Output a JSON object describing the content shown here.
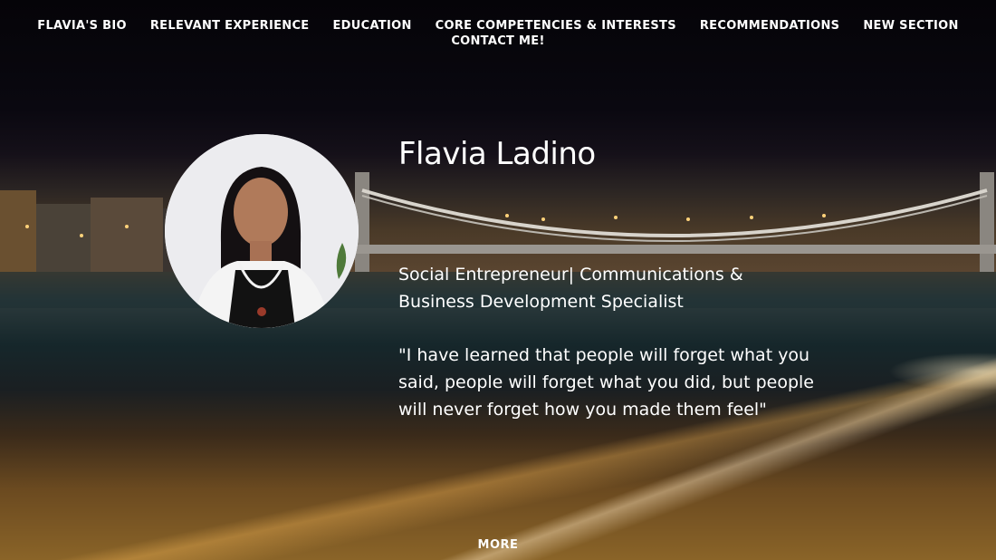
{
  "nav": {
    "items": [
      {
        "label": "FLAVIA'S BIO"
      },
      {
        "label": "RELEVANT EXPERIENCE"
      },
      {
        "label": "EDUCATION"
      },
      {
        "label": "CORE COMPETENCIES & INTERESTS"
      },
      {
        "label": "RECOMMENDATIONS"
      },
      {
        "label": "NEW SECTION"
      },
      {
        "label": "CONTACT ME!"
      }
    ]
  },
  "hero": {
    "name": "Flavia Ladino",
    "subtitle": "Social Entrepreneur| Communications & Business Development Specialist",
    "quote": "\"I have learned that people will forget what you said, people will forget what you did, but people will never forget how you made them feel\"",
    "more_label": "MORE"
  },
  "colors": {
    "text": "#ffffff",
    "background_night": "#0a0810"
  }
}
